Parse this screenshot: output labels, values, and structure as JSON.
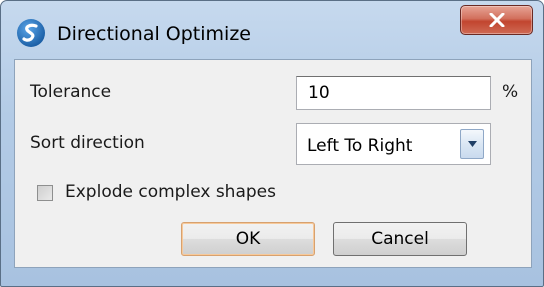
{
  "window": {
    "title": "Directional Optimize",
    "close_label": "x"
  },
  "form": {
    "tolerance_label": "Tolerance",
    "tolerance_value": "10",
    "tolerance_unit": "%",
    "sort_label": "Sort direction",
    "sort_selected": "Left To Right",
    "explode_label": "Explode complex shapes",
    "explode_checked": false
  },
  "buttons": {
    "ok_label": "OK",
    "cancel_label": "Cancel"
  },
  "icons": {
    "app": "app-logo-icon",
    "close": "close-icon",
    "dropdown": "chevron-down-icon"
  },
  "colors": {
    "frame": "#b3cbe6",
    "close_button": "#c2452f",
    "client_bg": "#f0f0f0",
    "default_button_border": "#d7a16f"
  }
}
